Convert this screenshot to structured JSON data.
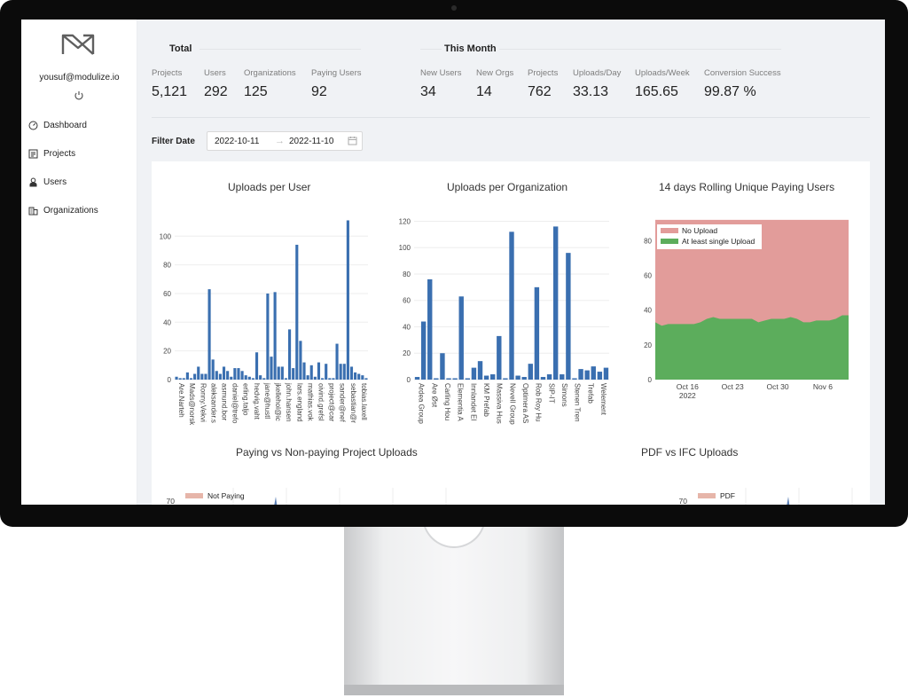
{
  "sidebar": {
    "user_email": "yousuf@modulize.io",
    "items": [
      {
        "label": "Dashboard",
        "icon": "dashboard-icon"
      },
      {
        "label": "Projects",
        "icon": "projects-icon"
      },
      {
        "label": "Users",
        "icon": "users-icon"
      },
      {
        "label": "Organizations",
        "icon": "organizations-icon"
      }
    ]
  },
  "total": {
    "title": "Total",
    "stats": [
      {
        "label": "Projects",
        "value": "5,121"
      },
      {
        "label": "Users",
        "value": "292"
      },
      {
        "label": "Organizations",
        "value": "125"
      },
      {
        "label": "Paying Users",
        "value": "92"
      }
    ]
  },
  "month": {
    "title": "This Month",
    "stats": [
      {
        "label": "New Users",
        "value": "34"
      },
      {
        "label": "New Orgs",
        "value": "14"
      },
      {
        "label": "Projects",
        "value": "762"
      },
      {
        "label": "Uploads/Day",
        "value": "33.13"
      },
      {
        "label": "Uploads/Week",
        "value": "165.65"
      },
      {
        "label": "Conversion Success",
        "value": "99.87 %"
      }
    ]
  },
  "filter": {
    "label": "Filter Date",
    "start": "2022-10-11",
    "end": "2022-11-10"
  },
  "colors": {
    "bar": "#3a6fb0",
    "no_upload": "#e29c9a",
    "upload": "#5cad5c",
    "accent": "#1f1f1f"
  },
  "chart_data": [
    {
      "type": "bar",
      "title": "Uploads per User",
      "ylim": [
        0,
        115
      ],
      "yticks": [
        0,
        20,
        40,
        60,
        80,
        100
      ],
      "categories": [
        "Are.Narteh",
        "",
        "Mads@norsk",
        "",
        "Ronny.Vekvi",
        "",
        "aleksander.s",
        "",
        "asmund.bor",
        "",
        "daniel@trefo",
        "",
        "erling.taljo",
        "",
        "hedvig.vaht",
        "",
        "jane@hustl",
        "",
        "jkellehol@ic",
        "",
        "john.hansen",
        "",
        "lars.england",
        "",
        "mathias.vok",
        "",
        "oivind.grefsl",
        "",
        "project@car",
        "",
        "sander@nef",
        "",
        "sebastian@r",
        "",
        "tobias.laxell",
        ""
      ],
      "values": [
        2,
        1,
        1,
        5,
        1,
        4,
        9,
        4,
        4,
        63,
        14,
        6,
        4,
        9,
        6,
        2,
        8,
        8,
        6,
        3,
        2,
        1,
        19,
        3,
        1,
        60,
        16,
        61,
        9,
        9,
        1,
        35,
        8,
        94,
        27,
        12,
        3,
        10,
        2,
        12,
        1,
        11,
        1,
        1,
        25,
        11,
        11,
        111,
        9,
        5,
        4,
        3,
        1
      ]
    },
    {
      "type": "bar",
      "title": "Uploads per Organization",
      "ylim": [
        0,
        125
      ],
      "yticks": [
        0,
        20,
        40,
        60,
        80,
        100,
        120
      ],
      "categories": [
        "Ardea Group",
        "",
        "Are Øst",
        "",
        "Carling Hou",
        "",
        "Elementia A",
        "",
        "Innlandet El",
        "",
        "KM Prefab",
        "",
        "Massiva Hus",
        "",
        "Nevell Group",
        "",
        "Optimera AS",
        "",
        "Rob Roy Hu",
        "",
        "SIP-IT",
        "",
        "Simons",
        "",
        "Stenen Tren",
        "",
        "Trefab",
        "",
        "Welement",
        ""
      ],
      "values": [
        2,
        44,
        76,
        1,
        20,
        1,
        1,
        63,
        1,
        9,
        14,
        3,
        4,
        33,
        1,
        112,
        3,
        2,
        12,
        70,
        2,
        4,
        116,
        4,
        96,
        1,
        8,
        7,
        10,
        6,
        9
      ]
    },
    {
      "type": "area",
      "title": "14 days Rolling Unique Paying Users",
      "ylim": [
        0,
        95
      ],
      "yticks": [
        0,
        20,
        40,
        60,
        80
      ],
      "xticks": [
        "Oct 16\n2022",
        "Oct 23",
        "Oct 30",
        "Nov 6"
      ],
      "series": [
        {
          "name": "No Upload",
          "values": [
            92,
            92,
            92,
            92,
            92,
            92,
            92,
            92,
            92,
            92,
            92,
            92,
            92,
            92,
            92,
            92,
            92,
            92,
            92,
            92,
            92,
            92,
            92,
            92,
            92,
            92,
            92,
            92,
            92,
            92,
            92
          ]
        },
        {
          "name": "At least single Upload",
          "values": [
            33,
            31,
            32,
            32,
            32,
            32,
            32,
            33,
            35,
            36,
            35,
            35,
            35,
            35,
            35,
            35,
            33,
            34,
            35,
            35,
            35,
            36,
            35,
            33,
            33,
            34,
            34,
            34,
            35,
            37,
            37
          ]
        }
      ]
    },
    {
      "type": "area",
      "title": "Paying vs Non-paying Project Uploads",
      "yticks": [
        70
      ],
      "series": [
        {
          "name": "Not Paying",
          "values": []
        }
      ]
    },
    {
      "type": "area",
      "title": "PDF vs IFC Uploads",
      "yticks": [
        70
      ],
      "series": [
        {
          "name": "PDF",
          "values": []
        }
      ]
    }
  ]
}
